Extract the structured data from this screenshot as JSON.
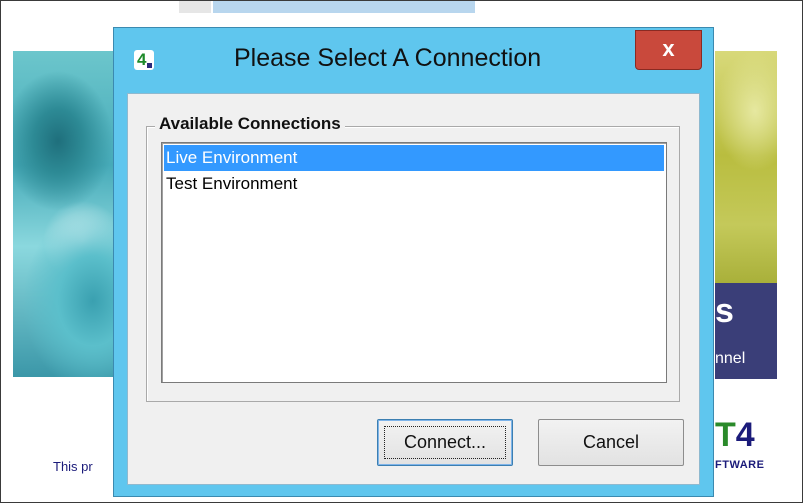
{
  "background": {
    "splash_left_text": "This pr",
    "purple_panel": {
      "letter": "s",
      "text": "nnel"
    },
    "brand": {
      "mark_prefix": "T",
      "mark_suffix": "4",
      "subtext": "FTWARE"
    }
  },
  "dialog": {
    "title": "Please Select A Connection",
    "close_label": "x",
    "group_label": "Available Connections",
    "connections": [
      {
        "label": "Live Environment",
        "selected": true
      },
      {
        "label": "Test Environment",
        "selected": false
      }
    ],
    "buttons": {
      "connect": "Connect...",
      "cancel": "Cancel"
    }
  },
  "colors": {
    "title_bar": "#5fc6ee",
    "close_button": "#c9493c",
    "selection": "#3399ff"
  },
  "icons": {
    "app": "app-logo-icon",
    "close": "close-icon"
  }
}
